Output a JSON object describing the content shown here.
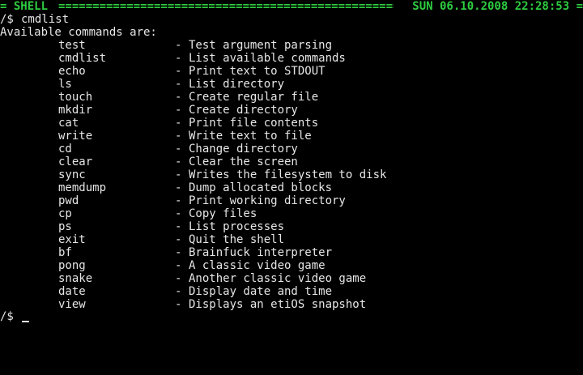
{
  "status_bar": {
    "app_label": "= SHELL",
    "fill": "==================================================================================================",
    "datetime": "SUN 06.10.2008 22:28:53 ="
  },
  "session": {
    "prompt": "/$",
    "entered_command": "cmdlist",
    "output_header": "Available commands are:",
    "separator": "-"
  },
  "commands": [
    {
      "name": "test",
      "description": "Test argument parsing"
    },
    {
      "name": "cmdlist",
      "description": "List available commands"
    },
    {
      "name": "echo",
      "description": "Print text to STDOUT"
    },
    {
      "name": "ls",
      "description": "List directory"
    },
    {
      "name": "touch",
      "description": "Create regular file"
    },
    {
      "name": "mkdir",
      "description": "Create directory"
    },
    {
      "name": "cat",
      "description": "Print file contents"
    },
    {
      "name": "write",
      "description": "Write text to file"
    },
    {
      "name": "cd",
      "description": "Change directory"
    },
    {
      "name": "clear",
      "description": "Clear the screen"
    },
    {
      "name": "sync",
      "description": "Writes the filesystem to disk"
    },
    {
      "name": "memdump",
      "description": "Dump allocated blocks"
    },
    {
      "name": "pwd",
      "description": "Print working directory"
    },
    {
      "name": "cp",
      "description": "Copy files"
    },
    {
      "name": "ps",
      "description": "List processes"
    },
    {
      "name": "exit",
      "description": "Quit the shell"
    },
    {
      "name": "bf",
      "description": "Brainfuck interpreter"
    },
    {
      "name": "pong",
      "description": "A classic video game"
    },
    {
      "name": "snake",
      "description": "Another classic video game"
    },
    {
      "name": "date",
      "description": "Display date and time"
    },
    {
      "name": "view",
      "description": "Displays an etiOS snapshot"
    }
  ],
  "input_line": {
    "prompt": "/$",
    "value": ""
  },
  "colors": {
    "background": "#000000",
    "text": "#e6e6e6",
    "status": "#2ecc40"
  }
}
